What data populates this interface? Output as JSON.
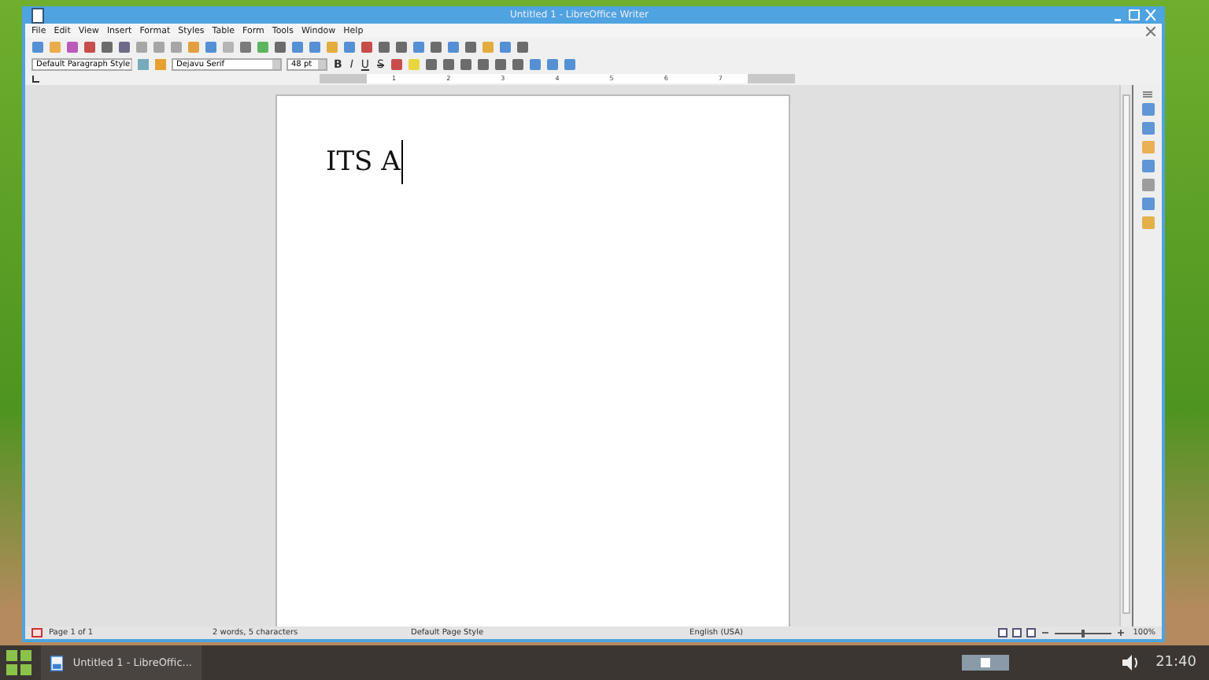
{
  "window": {
    "title": "Untitled 1 - LibreOffice Writer"
  },
  "menu": [
    "File",
    "Edit",
    "View",
    "Insert",
    "Format",
    "Styles",
    "Table",
    "Form",
    "Tools",
    "Window",
    "Help"
  ],
  "formatting": {
    "paragraph_style": "Default Paragraph Style",
    "font_name": "Dejavu Serif",
    "font_size": "48 pt",
    "buttons": [
      {
        "label": "B",
        "kind": "bold"
      },
      {
        "label": "I",
        "kind": "italic"
      },
      {
        "label": "U",
        "kind": "underline"
      },
      {
        "label": "S",
        "kind": "strike"
      }
    ]
  },
  "ruler": {
    "labels": [
      "1",
      "2",
      "3",
      "4",
      "5",
      "6",
      "7"
    ]
  },
  "document": {
    "text": "ITS A"
  },
  "status_bar": {
    "page": "Page 1 of 1",
    "counts": "2 words, 5 characters",
    "page_style": "Default Page Style",
    "language": "English (USA)",
    "zoom": "100%",
    "zoom_level": {
      "level": 0.5
    }
  },
  "taskbar": {
    "task": "Untitled 1 - LibreOffic...",
    "clock": "21:40"
  }
}
